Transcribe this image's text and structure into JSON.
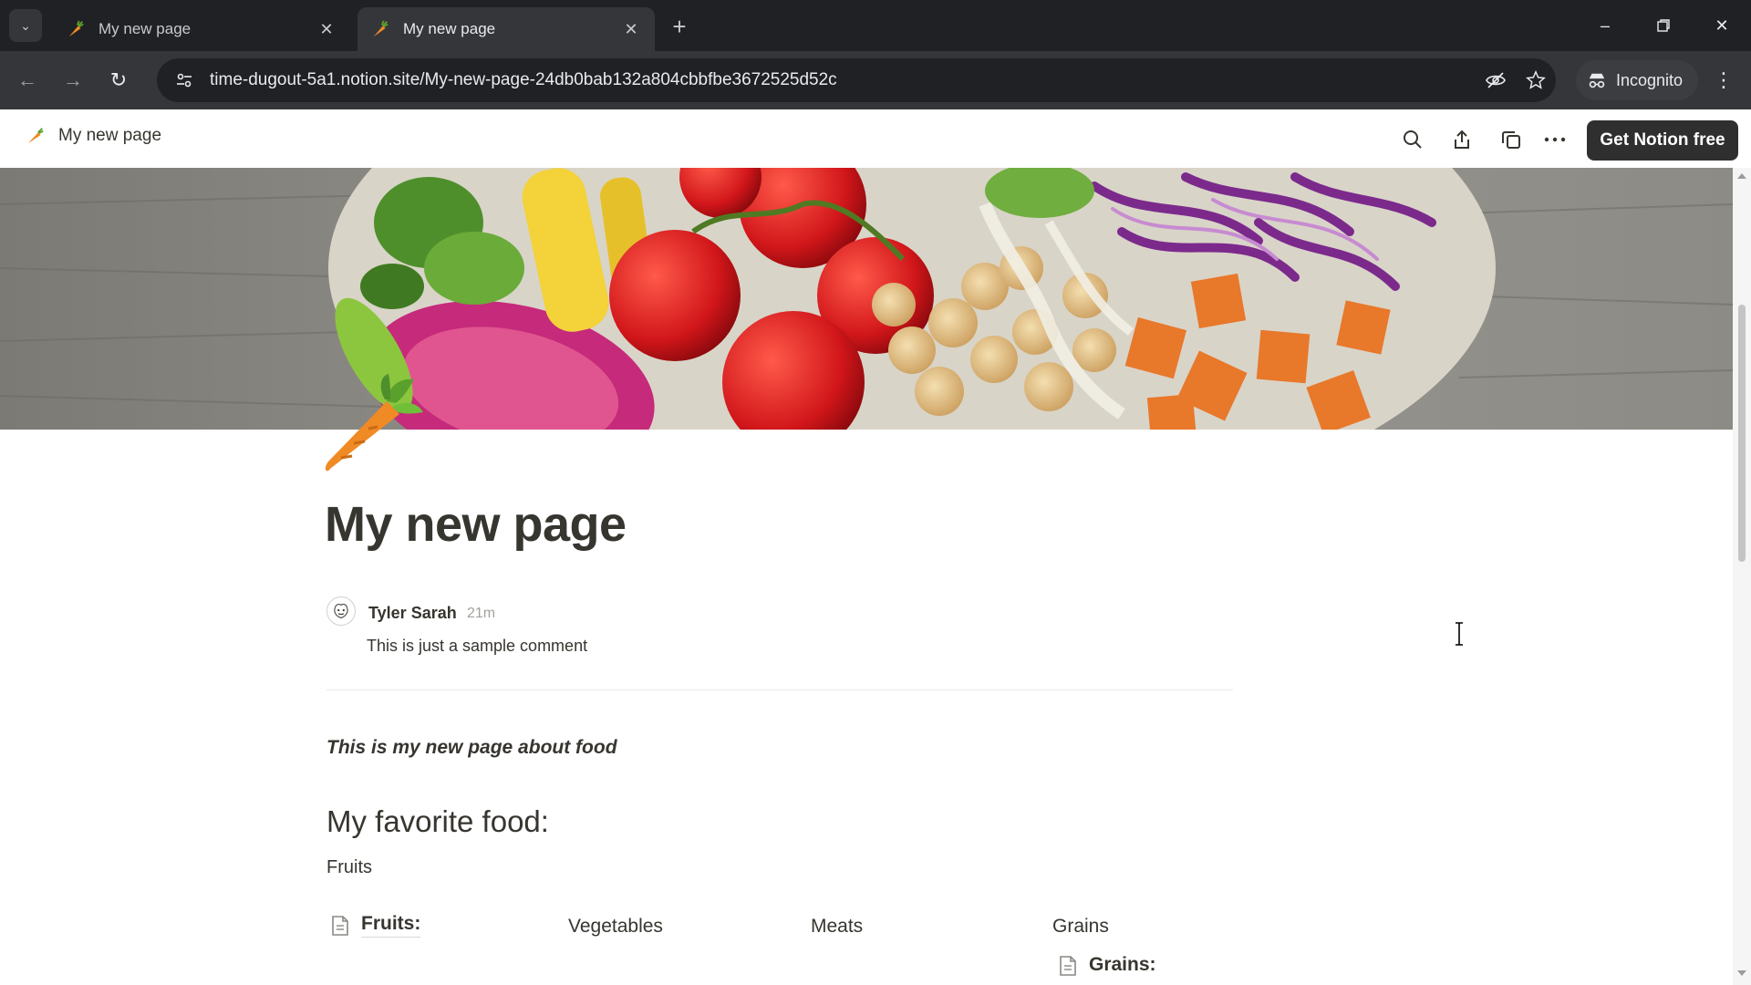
{
  "browser": {
    "tabs": [
      {
        "title": "My new page",
        "active": false
      },
      {
        "title": "My new page",
        "active": true
      }
    ],
    "url": "time-dugout-5a1.notion.site/My-new-page-24db0bab132a804cbbfbe3672525d52c",
    "incognito_label": "Incognito"
  },
  "notion": {
    "breadcrumb_title": "My new page",
    "get_notion_label": "Get Notion free"
  },
  "page": {
    "title": "My new page",
    "comment": {
      "author": "Tyler Sarah",
      "time": "21m",
      "body": "This is just a sample comment"
    },
    "intro": "This is my new page about food",
    "heading": "My favorite food:",
    "paragraph": "Fruits",
    "columns": {
      "col1_link": "Fruits:",
      "col2_text": "Vegetables",
      "col3_text": "Meats",
      "col4_text": "Grains",
      "col4_link": "Grains:"
    }
  },
  "colors": {
    "chrome_dark": "#202124",
    "chrome_toolbar": "#35363a",
    "notion_text": "#37352f",
    "button_dark": "#2f2f2f"
  }
}
